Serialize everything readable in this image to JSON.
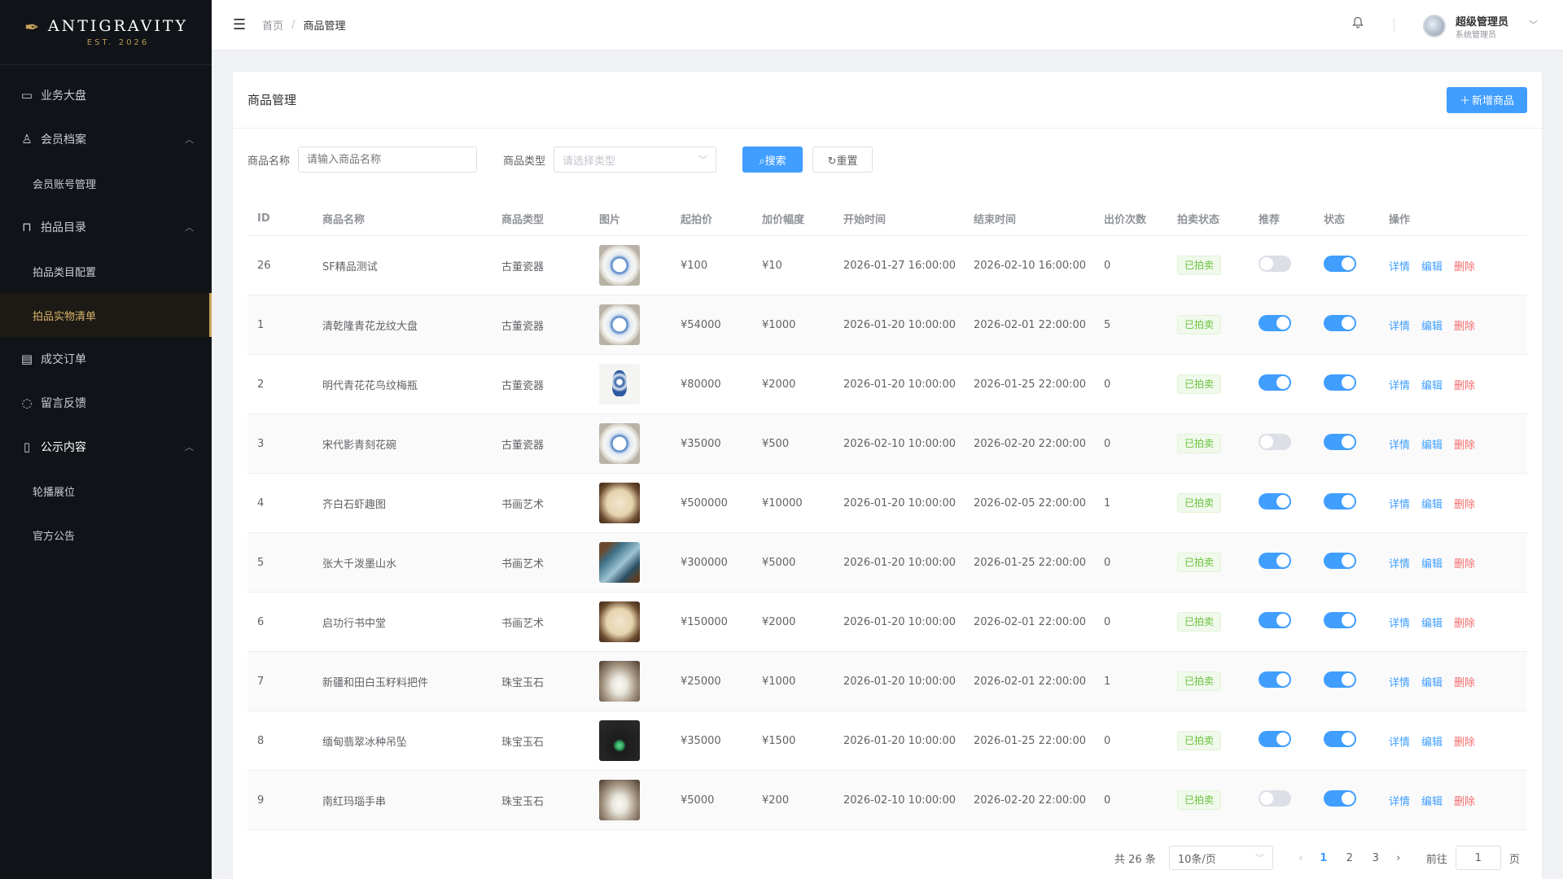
{
  "brand": {
    "name": "ANTIGRAVITY",
    "sub": "EST. 2026"
  },
  "sidebar": {
    "items": [
      {
        "label": "业务大盘",
        "icon": "monitor-icon"
      },
      {
        "label": "会员档案",
        "icon": "user-icon"
      },
      {
        "label": "会员账号管理"
      },
      {
        "label": "拍品目录",
        "icon": "bag-icon"
      },
      {
        "label": "拍品类目配置"
      },
      {
        "label": "拍品实物清单"
      },
      {
        "label": "成交订单",
        "icon": "receipt-icon"
      },
      {
        "label": "留言反馈",
        "icon": "chat-icon"
      },
      {
        "label": "公示内容",
        "icon": "document-icon"
      },
      {
        "label": "轮播展位"
      },
      {
        "label": "官方公告"
      }
    ]
  },
  "header": {
    "breadcrumb_home": "首页",
    "breadcrumb_sep": "/",
    "breadcrumb_current": "商品管理",
    "user_name": "超级管理员",
    "user_role": "系统管理员"
  },
  "card": {
    "title": "商品管理",
    "add_button": "新增商品"
  },
  "filters": {
    "name_label": "商品名称",
    "name_placeholder": "请输入商品名称",
    "type_label": "商品类型",
    "type_placeholder": "请选择类型",
    "search_button": "搜索",
    "reset_button": "重置"
  },
  "table": {
    "headers": [
      "ID",
      "商品名称",
      "商品类型",
      "图片",
      "起拍价",
      "加价幅度",
      "开始时间",
      "结束时间",
      "出价次数",
      "拍卖状态",
      "推荐",
      "状态",
      "操作"
    ],
    "actions": {
      "detail": "详情",
      "edit": "编辑",
      "delete": "删除"
    },
    "rows": [
      {
        "id": "26",
        "name": "SF精品测试",
        "type": "古董瓷器",
        "image": "plate",
        "start_price": "¥100",
        "increment": "¥10",
        "start_time": "2026-01-27 16:00:00",
        "end_time": "2026-02-10 16:00:00",
        "bids": "0",
        "status": "已拍卖",
        "recommended": false,
        "enabled": true
      },
      {
        "id": "1",
        "name": "清乾隆青花龙纹大盘",
        "type": "古董瓷器",
        "image": "plate",
        "start_price": "¥54000",
        "increment": "¥1000",
        "start_time": "2026-01-20 10:00:00",
        "end_time": "2026-02-01 22:00:00",
        "bids": "5",
        "status": "已拍卖",
        "recommended": true,
        "enabled": true
      },
      {
        "id": "2",
        "name": "明代青花花鸟纹梅瓶",
        "type": "古董瓷器",
        "image": "vase",
        "start_price": "¥80000",
        "increment": "¥2000",
        "start_time": "2026-01-20 10:00:00",
        "end_time": "2026-01-25 22:00:00",
        "bids": "0",
        "status": "已拍卖",
        "recommended": true,
        "enabled": true
      },
      {
        "id": "3",
        "name": "宋代影青刻花碗",
        "type": "古董瓷器",
        "image": "plate",
        "start_price": "¥35000",
        "increment": "¥500",
        "start_time": "2026-02-10 10:00:00",
        "end_time": "2026-02-20 22:00:00",
        "bids": "0",
        "status": "已拍卖",
        "recommended": false,
        "enabled": true
      },
      {
        "id": "4",
        "name": "齐白石虾趣图",
        "type": "书画艺术",
        "image": "paint1",
        "start_price": "¥500000",
        "increment": "¥10000",
        "start_time": "2026-01-20 10:00:00",
        "end_time": "2026-02-05 22:00:00",
        "bids": "1",
        "status": "已拍卖",
        "recommended": true,
        "enabled": true
      },
      {
        "id": "5",
        "name": "张大千泼墨山水",
        "type": "书画艺术",
        "image": "paint2",
        "start_price": "¥300000",
        "increment": "¥5000",
        "start_time": "2026-01-20 10:00:00",
        "end_time": "2026-01-25 22:00:00",
        "bids": "0",
        "status": "已拍卖",
        "recommended": true,
        "enabled": true
      },
      {
        "id": "6",
        "name": "启功行书中堂",
        "type": "书画艺术",
        "image": "paint1",
        "start_price": "¥150000",
        "increment": "¥2000",
        "start_time": "2026-01-20 10:00:00",
        "end_time": "2026-02-01 22:00:00",
        "bids": "0",
        "status": "已拍卖",
        "recommended": true,
        "enabled": true
      },
      {
        "id": "7",
        "name": "新疆和田白玉籽料把件",
        "type": "珠宝玉石",
        "image": "jade1",
        "start_price": "¥25000",
        "increment": "¥1000",
        "start_time": "2026-01-20 10:00:00",
        "end_time": "2026-02-01 22:00:00",
        "bids": "1",
        "status": "已拍卖",
        "recommended": true,
        "enabled": true
      },
      {
        "id": "8",
        "name": "缅甸翡翠冰种吊坠",
        "type": "珠宝玉石",
        "image": "jade2",
        "start_price": "¥35000",
        "increment": "¥1500",
        "start_time": "2026-01-20 10:00:00",
        "end_time": "2026-01-25 22:00:00",
        "bids": "0",
        "status": "已拍卖",
        "recommended": true,
        "enabled": true
      },
      {
        "id": "9",
        "name": "南红玛瑙手串",
        "type": "珠宝玉石",
        "image": "jade1",
        "start_price": "¥5000",
        "increment": "¥200",
        "start_time": "2026-02-10 10:00:00",
        "end_time": "2026-02-20 22:00:00",
        "bids": "0",
        "status": "已拍卖",
        "recommended": false,
        "enabled": true
      }
    ]
  },
  "pagination": {
    "total": "共 26 条",
    "page_size": "10条/页",
    "pages": [
      "1",
      "2",
      "3"
    ],
    "current_page": "1",
    "goto_label": "前往",
    "goto_value": "1",
    "goto_unit": "页"
  },
  "colors": {
    "primary": "#409eff",
    "danger": "#f56c6c",
    "success": "#67c23a",
    "sidebar_bg": "#101317",
    "accent_gold": "#c9a45c"
  }
}
